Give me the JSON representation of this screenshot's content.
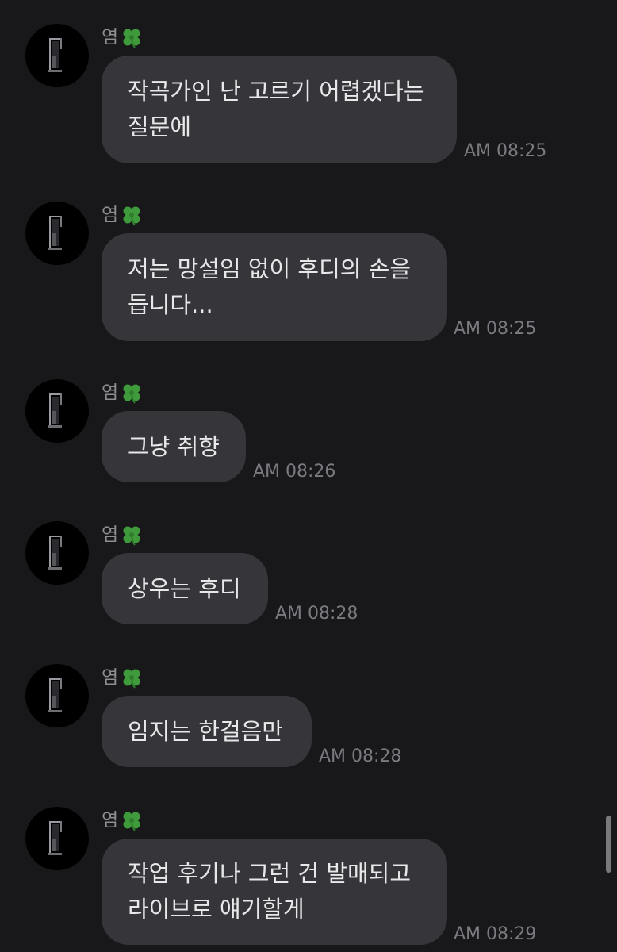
{
  "colors": {
    "background": "#18181a",
    "bubble": "#35353a",
    "bubble_text": "#e8e8ea",
    "sender_text": "#8d8d92",
    "time_text": "#7a7a80",
    "avatar": "#000000"
  },
  "messages": [
    {
      "sender": "염",
      "sender_icon": "four-leaf-clover-icon",
      "lines": [
        "작곡가인 난 고르기 어렵겠다는",
        "질문에"
      ],
      "time": "AM 08:25"
    },
    {
      "sender": "염",
      "sender_icon": "four-leaf-clover-icon",
      "lines": [
        "저는 망설임 없이 후디의 손을",
        "듭니다..."
      ],
      "time": "AM 08:25"
    },
    {
      "sender": "염",
      "sender_icon": "four-leaf-clover-icon",
      "lines": [
        "그냥 취향"
      ],
      "time": "AM 08:26"
    },
    {
      "sender": "염",
      "sender_icon": "four-leaf-clover-icon",
      "lines": [
        "상우는 후디"
      ],
      "time": "AM 08:28"
    },
    {
      "sender": "염",
      "sender_icon": "four-leaf-clover-icon",
      "lines": [
        "임지는 한걸음만"
      ],
      "time": "AM 08:28"
    },
    {
      "sender": "염",
      "sender_icon": "four-leaf-clover-icon",
      "lines": [
        "작업 후기나 그런 건 발매되고",
        "라이브로 얘기할게"
      ],
      "time": "AM 08:29"
    }
  ]
}
